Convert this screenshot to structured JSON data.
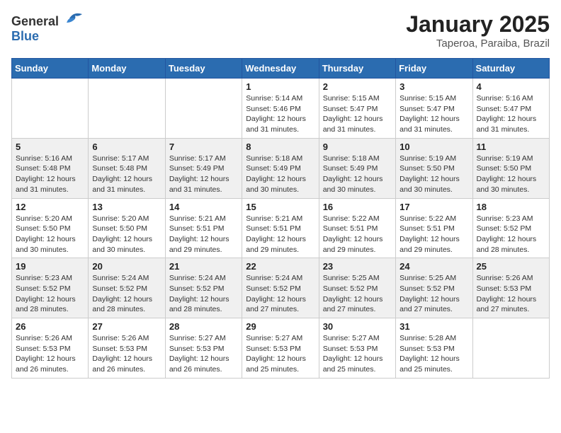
{
  "logo": {
    "general": "General",
    "blue": "Blue"
  },
  "title": {
    "month_year": "January 2025",
    "location": "Taperoa, Paraiba, Brazil"
  },
  "weekdays": [
    "Sunday",
    "Monday",
    "Tuesday",
    "Wednesday",
    "Thursday",
    "Friday",
    "Saturday"
  ],
  "weeks": [
    [
      {
        "day": "",
        "sunrise": "",
        "sunset": "",
        "daylight": ""
      },
      {
        "day": "",
        "sunrise": "",
        "sunset": "",
        "daylight": ""
      },
      {
        "day": "",
        "sunrise": "",
        "sunset": "",
        "daylight": ""
      },
      {
        "day": "1",
        "sunrise": "Sunrise: 5:14 AM",
        "sunset": "Sunset: 5:46 PM",
        "daylight": "Daylight: 12 hours and 31 minutes."
      },
      {
        "day": "2",
        "sunrise": "Sunrise: 5:15 AM",
        "sunset": "Sunset: 5:47 PM",
        "daylight": "Daylight: 12 hours and 31 minutes."
      },
      {
        "day": "3",
        "sunrise": "Sunrise: 5:15 AM",
        "sunset": "Sunset: 5:47 PM",
        "daylight": "Daylight: 12 hours and 31 minutes."
      },
      {
        "day": "4",
        "sunrise": "Sunrise: 5:16 AM",
        "sunset": "Sunset: 5:47 PM",
        "daylight": "Daylight: 12 hours and 31 minutes."
      }
    ],
    [
      {
        "day": "5",
        "sunrise": "Sunrise: 5:16 AM",
        "sunset": "Sunset: 5:48 PM",
        "daylight": "Daylight: 12 hours and 31 minutes."
      },
      {
        "day": "6",
        "sunrise": "Sunrise: 5:17 AM",
        "sunset": "Sunset: 5:48 PM",
        "daylight": "Daylight: 12 hours and 31 minutes."
      },
      {
        "day": "7",
        "sunrise": "Sunrise: 5:17 AM",
        "sunset": "Sunset: 5:49 PM",
        "daylight": "Daylight: 12 hours and 31 minutes."
      },
      {
        "day": "8",
        "sunrise": "Sunrise: 5:18 AM",
        "sunset": "Sunset: 5:49 PM",
        "daylight": "Daylight: 12 hours and 30 minutes."
      },
      {
        "day": "9",
        "sunrise": "Sunrise: 5:18 AM",
        "sunset": "Sunset: 5:49 PM",
        "daylight": "Daylight: 12 hours and 30 minutes."
      },
      {
        "day": "10",
        "sunrise": "Sunrise: 5:19 AM",
        "sunset": "Sunset: 5:50 PM",
        "daylight": "Daylight: 12 hours and 30 minutes."
      },
      {
        "day": "11",
        "sunrise": "Sunrise: 5:19 AM",
        "sunset": "Sunset: 5:50 PM",
        "daylight": "Daylight: 12 hours and 30 minutes."
      }
    ],
    [
      {
        "day": "12",
        "sunrise": "Sunrise: 5:20 AM",
        "sunset": "Sunset: 5:50 PM",
        "daylight": "Daylight: 12 hours and 30 minutes."
      },
      {
        "day": "13",
        "sunrise": "Sunrise: 5:20 AM",
        "sunset": "Sunset: 5:50 PM",
        "daylight": "Daylight: 12 hours and 30 minutes."
      },
      {
        "day": "14",
        "sunrise": "Sunrise: 5:21 AM",
        "sunset": "Sunset: 5:51 PM",
        "daylight": "Daylight: 12 hours and 29 minutes."
      },
      {
        "day": "15",
        "sunrise": "Sunrise: 5:21 AM",
        "sunset": "Sunset: 5:51 PM",
        "daylight": "Daylight: 12 hours and 29 minutes."
      },
      {
        "day": "16",
        "sunrise": "Sunrise: 5:22 AM",
        "sunset": "Sunset: 5:51 PM",
        "daylight": "Daylight: 12 hours and 29 minutes."
      },
      {
        "day": "17",
        "sunrise": "Sunrise: 5:22 AM",
        "sunset": "Sunset: 5:51 PM",
        "daylight": "Daylight: 12 hours and 29 minutes."
      },
      {
        "day": "18",
        "sunrise": "Sunrise: 5:23 AM",
        "sunset": "Sunset: 5:52 PM",
        "daylight": "Daylight: 12 hours and 28 minutes."
      }
    ],
    [
      {
        "day": "19",
        "sunrise": "Sunrise: 5:23 AM",
        "sunset": "Sunset: 5:52 PM",
        "daylight": "Daylight: 12 hours and 28 minutes."
      },
      {
        "day": "20",
        "sunrise": "Sunrise: 5:24 AM",
        "sunset": "Sunset: 5:52 PM",
        "daylight": "Daylight: 12 hours and 28 minutes."
      },
      {
        "day": "21",
        "sunrise": "Sunrise: 5:24 AM",
        "sunset": "Sunset: 5:52 PM",
        "daylight": "Daylight: 12 hours and 28 minutes."
      },
      {
        "day": "22",
        "sunrise": "Sunrise: 5:24 AM",
        "sunset": "Sunset: 5:52 PM",
        "daylight": "Daylight: 12 hours and 27 minutes."
      },
      {
        "day": "23",
        "sunrise": "Sunrise: 5:25 AM",
        "sunset": "Sunset: 5:52 PM",
        "daylight": "Daylight: 12 hours and 27 minutes."
      },
      {
        "day": "24",
        "sunrise": "Sunrise: 5:25 AM",
        "sunset": "Sunset: 5:52 PM",
        "daylight": "Daylight: 12 hours and 27 minutes."
      },
      {
        "day": "25",
        "sunrise": "Sunrise: 5:26 AM",
        "sunset": "Sunset: 5:53 PM",
        "daylight": "Daylight: 12 hours and 27 minutes."
      }
    ],
    [
      {
        "day": "26",
        "sunrise": "Sunrise: 5:26 AM",
        "sunset": "Sunset: 5:53 PM",
        "daylight": "Daylight: 12 hours and 26 minutes."
      },
      {
        "day": "27",
        "sunrise": "Sunrise: 5:26 AM",
        "sunset": "Sunset: 5:53 PM",
        "daylight": "Daylight: 12 hours and 26 minutes."
      },
      {
        "day": "28",
        "sunrise": "Sunrise: 5:27 AM",
        "sunset": "Sunset: 5:53 PM",
        "daylight": "Daylight: 12 hours and 26 minutes."
      },
      {
        "day": "29",
        "sunrise": "Sunrise: 5:27 AM",
        "sunset": "Sunset: 5:53 PM",
        "daylight": "Daylight: 12 hours and 25 minutes."
      },
      {
        "day": "30",
        "sunrise": "Sunrise: 5:27 AM",
        "sunset": "Sunset: 5:53 PM",
        "daylight": "Daylight: 12 hours and 25 minutes."
      },
      {
        "day": "31",
        "sunrise": "Sunrise: 5:28 AM",
        "sunset": "Sunset: 5:53 PM",
        "daylight": "Daylight: 12 hours and 25 minutes."
      },
      {
        "day": "",
        "sunrise": "",
        "sunset": "",
        "daylight": ""
      }
    ]
  ]
}
